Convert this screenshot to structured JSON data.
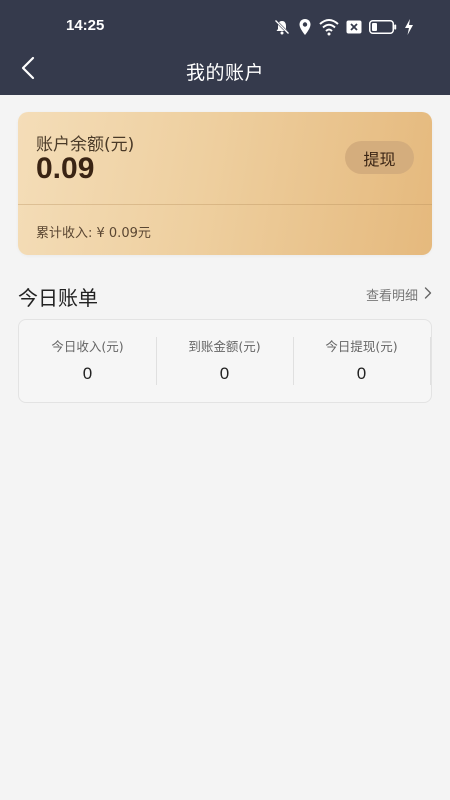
{
  "status_bar": {
    "time": "14:25",
    "icons": [
      "bell-muted-icon",
      "location-icon",
      "wifi-icon",
      "sim-blocked-icon",
      "battery-icon",
      "charging-icon"
    ]
  },
  "nav": {
    "title": "我的账户",
    "back_icon": "chevron-left-icon"
  },
  "balance_card": {
    "label": "账户余额(元)",
    "value": "0.09",
    "withdraw_label": "提现",
    "cumulative_text": "累计收入: ¥ 0.09元"
  },
  "today": {
    "title": "今日账单",
    "detail_link": "查看明细",
    "stats": [
      {
        "label": "今日收入(元)",
        "value": "0"
      },
      {
        "label": "到账金额(元)",
        "value": "0"
      },
      {
        "label": "今日提现(元)",
        "value": "0"
      }
    ]
  },
  "colors": {
    "header_bg": "#353a4c",
    "page_bg": "#f4f4f4",
    "card_gradient_start": "#f4ddb8",
    "card_gradient_end": "#e5b97d",
    "withdraw_button_bg": "#d4ad7d"
  }
}
